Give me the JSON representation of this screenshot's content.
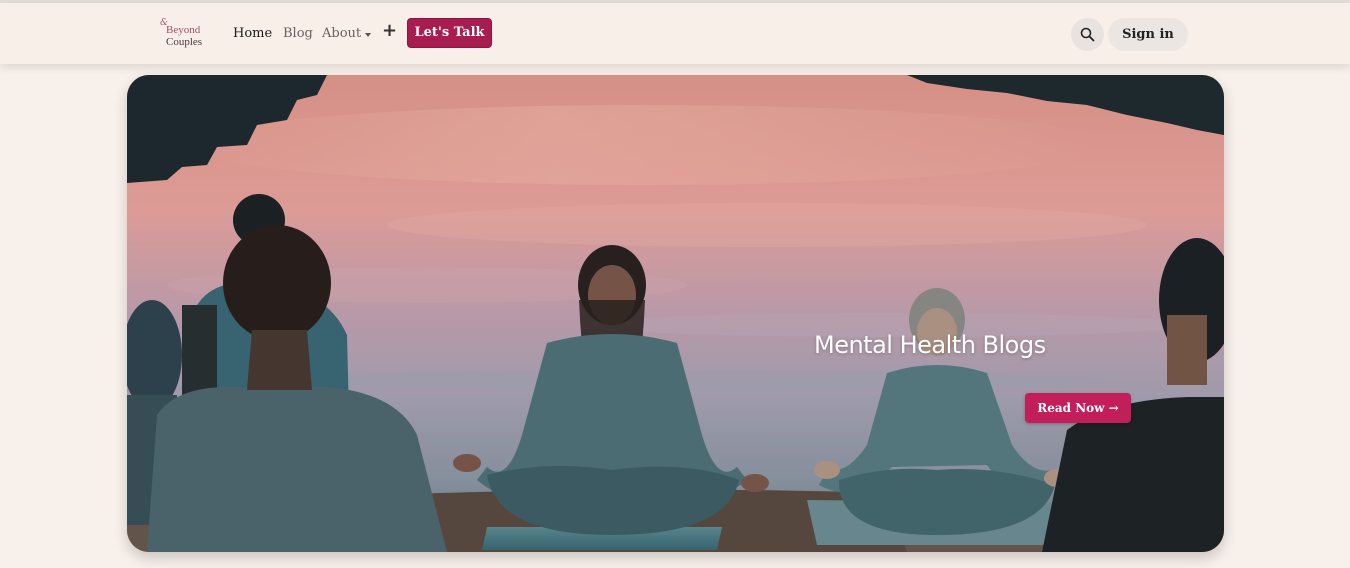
{
  "brand": {
    "ampersand": "&",
    "line1": "Beyond",
    "line2": "Couples"
  },
  "nav": {
    "home": "Home",
    "blog": "Blog",
    "about": "About",
    "cta": "Let's Talk"
  },
  "header_right": {
    "search_icon": "search-icon",
    "sign_in": "Sign in"
  },
  "hero": {
    "title": "Mental Health Blogs",
    "button": "Read Now →",
    "image": "group-meditation-by-lake-at-sunset"
  },
  "colors": {
    "page_bg": "#f8f0ea",
    "accent": "#a81d4f",
    "read_button": "#c21e5a"
  }
}
